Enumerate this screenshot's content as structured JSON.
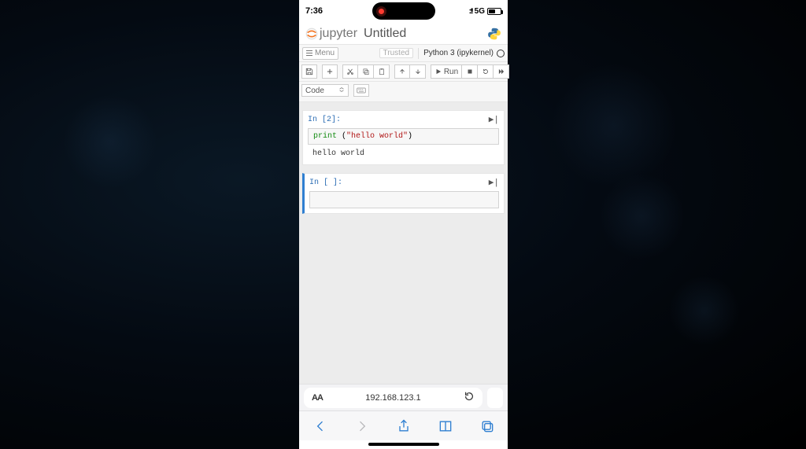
{
  "statusbar": {
    "time": "7:36",
    "network": "5G",
    "signal_text": "::!!"
  },
  "header": {
    "brand": "jupyter",
    "title": "Untitled"
  },
  "menubar": {
    "menu_label": "Menu",
    "trusted": "Trusted",
    "kernel": "Python 3 (ipykernel)"
  },
  "toolbar": {
    "run_label": "Run"
  },
  "celltype": {
    "selected": "Code"
  },
  "cells": [
    {
      "prompt": "In [2]:",
      "code_kw": "print",
      "code_mid": " (",
      "code_str": "\"hello world\"",
      "code_end": ")",
      "output": "hello world"
    },
    {
      "prompt": "In [ ]:"
    }
  ],
  "browser": {
    "url": "192.168.123.1",
    "text_size": "AA"
  }
}
